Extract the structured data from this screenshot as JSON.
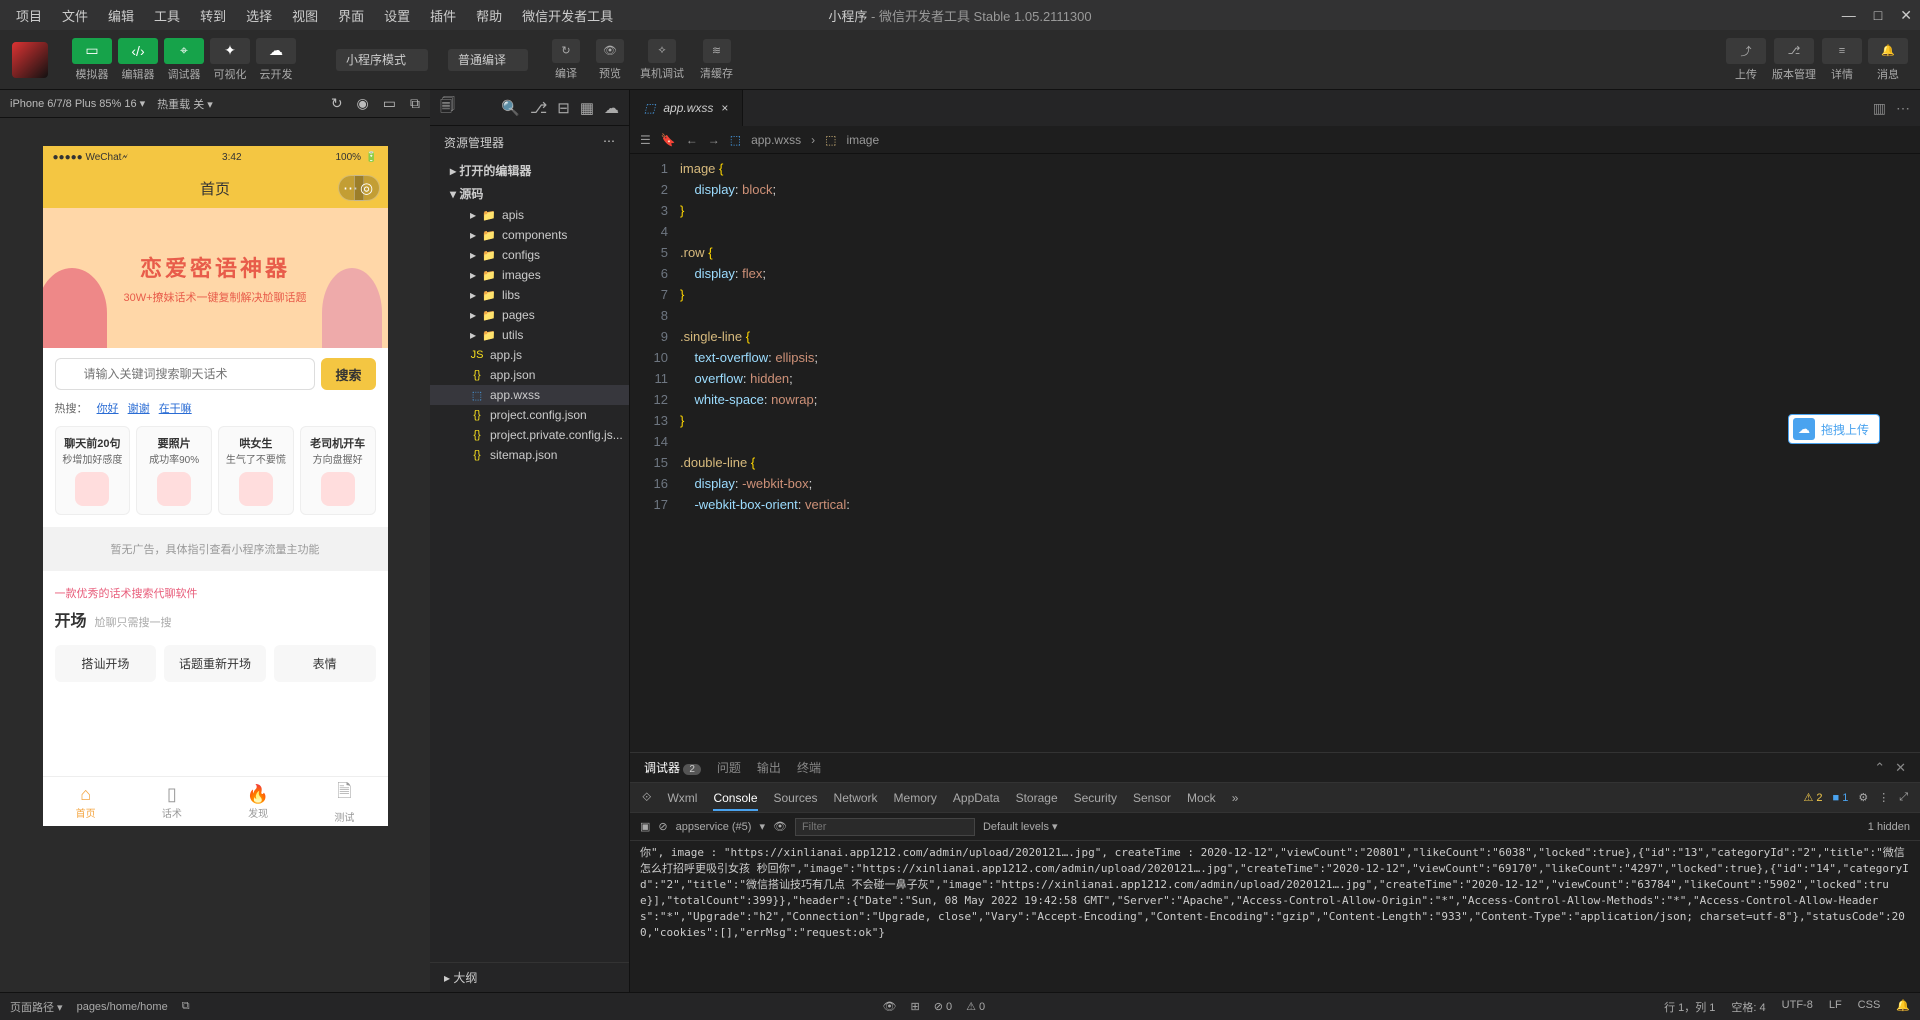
{
  "menubar": {
    "items": [
      "项目",
      "文件",
      "编辑",
      "工具",
      "转到",
      "选择",
      "视图",
      "界面",
      "设置",
      "插件",
      "帮助",
      "微信开发者工具"
    ],
    "title_app": "小程序",
    "title_suffix": " - 微信开发者工具 Stable 1.05.2111300"
  },
  "toolbar": {
    "group1": [
      {
        "label": "模拟器",
        "green": true,
        "glyph": "▭"
      },
      {
        "label": "编辑器",
        "green": true,
        "glyph": "‹/›"
      },
      {
        "label": "调试器",
        "green": true,
        "glyph": "⌖"
      },
      {
        "label": "可视化",
        "green": false,
        "glyph": "✦"
      },
      {
        "label": "云开发",
        "green": false,
        "glyph": "☁"
      }
    ],
    "mode": "小程序模式",
    "compile": "普通编译",
    "actions": [
      {
        "label": "编译",
        "glyph": "↻"
      },
      {
        "label": "预览",
        "glyph": "👁"
      },
      {
        "label": "真机调试",
        "glyph": "⟡"
      },
      {
        "label": "清缓存",
        "glyph": "≋"
      }
    ],
    "right": [
      {
        "label": "上传",
        "glyph": "⤴"
      },
      {
        "label": "版本管理",
        "glyph": "⎇"
      },
      {
        "label": "详情",
        "glyph": "≡"
      },
      {
        "label": "消息",
        "glyph": "🔔"
      }
    ]
  },
  "sim": {
    "device": "iPhone 6/7/8 Plus 85% 16 ▾",
    "reload": "热重载 关 ▾"
  },
  "phone": {
    "carrier": "●●●●● WeChat🗲",
    "clock": "3:42",
    "battery": "100%",
    "nav_title": "首页",
    "hero_t1": "恋爱密语神器",
    "hero_t2": "30W+撩妹话术一键复制解决尬聊话题",
    "search_placeholder": "请输入关键词搜索聊天话术",
    "search_btn": "搜索",
    "hot_label": "热搜：",
    "hot_links": [
      "你好",
      "谢谢",
      "在干嘛"
    ],
    "cards": [
      {
        "t": "聊天前20句",
        "s": "秒增加好感度"
      },
      {
        "t": "要照片",
        "s": "成功率90%"
      },
      {
        "t": "哄女生",
        "s": "生气了不要慌"
      },
      {
        "t": "老司机开车",
        "s": "方向盘握好"
      }
    ],
    "ad": "暂无广告，具体指引查看小程序流量主功能",
    "pink": "一款优秀的话术搜索代聊软件",
    "h3": "开场",
    "h3s": "尬聊只需搜一搜",
    "tabs": [
      "搭讪开场",
      "话题重新开场",
      "表情"
    ],
    "tabbar": [
      {
        "label": "首页",
        "glyph": "⌂",
        "active": true
      },
      {
        "label": "话术",
        "glyph": "▯",
        "active": false
      },
      {
        "label": "发现",
        "glyph": "🔥",
        "active": false
      },
      {
        "label": "测试",
        "glyph": "🗎",
        "active": false
      }
    ]
  },
  "explorer": {
    "title": "资源管理器",
    "sections": [
      {
        "label": "打开的编辑器",
        "expanded": false
      },
      {
        "label": "源码",
        "expanded": true
      }
    ],
    "tree": [
      {
        "name": "apis",
        "type": "folder"
      },
      {
        "name": "components",
        "type": "folder"
      },
      {
        "name": "configs",
        "type": "folder"
      },
      {
        "name": "images",
        "type": "folder"
      },
      {
        "name": "libs",
        "type": "folder"
      },
      {
        "name": "pages",
        "type": "folder"
      },
      {
        "name": "utils",
        "type": "folder"
      },
      {
        "name": "app.js",
        "type": "js"
      },
      {
        "name": "app.json",
        "type": "json"
      },
      {
        "name": "app.wxss",
        "type": "wxss",
        "active": true
      },
      {
        "name": "project.config.json",
        "type": "json"
      },
      {
        "name": "project.private.config.js...",
        "type": "json"
      },
      {
        "name": "sitemap.json",
        "type": "json"
      }
    ],
    "outline": "大纲"
  },
  "editor": {
    "tab": "app.wxss",
    "crumb": [
      "app.wxss",
      "image"
    ],
    "lines": [
      1,
      2,
      3,
      4,
      5,
      6,
      7,
      8,
      9,
      10,
      11,
      12,
      13,
      14,
      15,
      16,
      17
    ]
  },
  "float_upload": "拖拽上传",
  "panel": {
    "tabs": [
      {
        "label": "调试器",
        "badge": "2",
        "active": true
      },
      {
        "label": "问题"
      },
      {
        "label": "输出"
      },
      {
        "label": "终端"
      }
    ],
    "devtabs": [
      "Wxml",
      "Console",
      "Sources",
      "Network",
      "Memory",
      "AppData",
      "Storage",
      "Security",
      "Sensor",
      "Mock"
    ],
    "devtabs_active": "Console",
    "warn_count": "2",
    "info_count": "1",
    "context": "appservice (#5)",
    "filter_ph": "Filter",
    "levels": "Default levels ▾",
    "hidden": "1 hidden",
    "log_text": "你\", image : \"https://xinlianai.app1212.com/admin/upload/2020121….jpg\", createTime : 2020-12-12\",\"viewCount\":\"20801\",\"likeCount\":\"6038\",\"locked\":true},{\"id\":\"13\",\"categoryId\":\"2\",\"title\":\"微信怎么打招呼更吸引女孩 秒回你\",\"image\":\"https://xinlianai.app1212.com/admin/upload/2020121….jpg\",\"createTime\":\"2020-12-12\",\"viewCount\":\"69170\",\"likeCount\":\"4297\",\"locked\":true},{\"id\":\"14\",\"categoryId\":\"2\",\"title\":\"微信搭讪技巧有几点 不会碰一鼻子灰\",\"image\":\"https://xinlianai.app1212.com/admin/upload/2020121….jpg\",\"createTime\":\"2020-12-12\",\"viewCount\":\"63784\",\"likeCount\":\"5902\",\"locked\":true}],\"totalCount\":399}},\"header\":{\"Date\":\"Sun, 08 May 2022 19:42:58 GMT\",\"Server\":\"Apache\",\"Access-Control-Allow-Origin\":\"*\",\"Access-Control-Allow-Methods\":\"*\",\"Access-Control-Allow-Headers\":\"*\",\"Upgrade\":\"h2\",\"Connection\":\"Upgrade, close\",\"Vary\":\"Accept-Encoding\",\"Content-Encoding\":\"gzip\",\"Content-Length\":\"933\",\"Content-Type\":\"application/json; charset=utf-8\"},\"statusCode\":200,\"cookies\":[],\"errMsg\":\"request:ok\"}"
  },
  "status": {
    "page_label": "页面路径 ▾",
    "page_path": "pages/home/home",
    "errors": "⊘ 0",
    "warnings": "⚠ 0",
    "pos": "行 1，列 1",
    "spaces": "空格: 4",
    "enc": "UTF-8",
    "eol": "LF",
    "lang": "CSS"
  }
}
